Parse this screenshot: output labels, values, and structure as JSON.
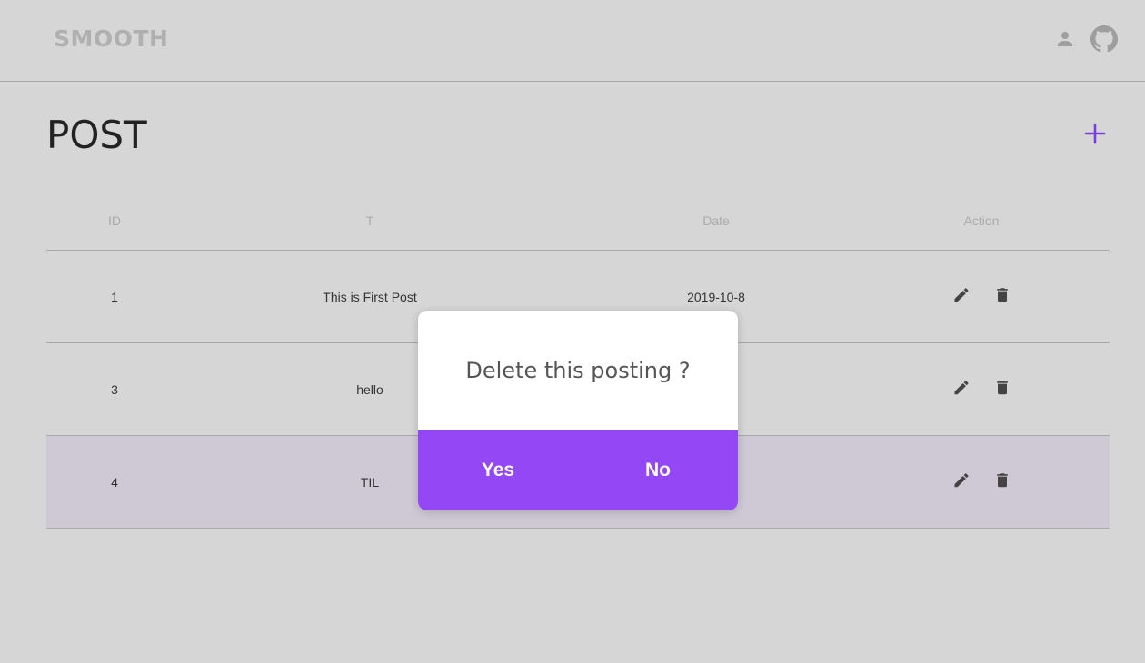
{
  "header": {
    "logo": "SMOOTH",
    "user_icon": "user-icon",
    "github_icon": "github-icon"
  },
  "page": {
    "title": "POST",
    "add_icon": "plus-icon"
  },
  "colors": {
    "accent": "#9347f5",
    "background": "#d6d6d6",
    "highlight_row": "#cfc9d5"
  },
  "table": {
    "columns": [
      "ID",
      "T",
      "Date",
      "Action"
    ],
    "rows": [
      {
        "id": "1",
        "title": "This is First Post",
        "date": "2019-10-8"
      },
      {
        "id": "3",
        "title": "hello",
        "date": "8"
      },
      {
        "id": "4",
        "title": "TIL",
        "date": "8"
      }
    ]
  },
  "dialog": {
    "message": "Delete this posting ?",
    "yes_label": "Yes",
    "no_label": "No"
  }
}
